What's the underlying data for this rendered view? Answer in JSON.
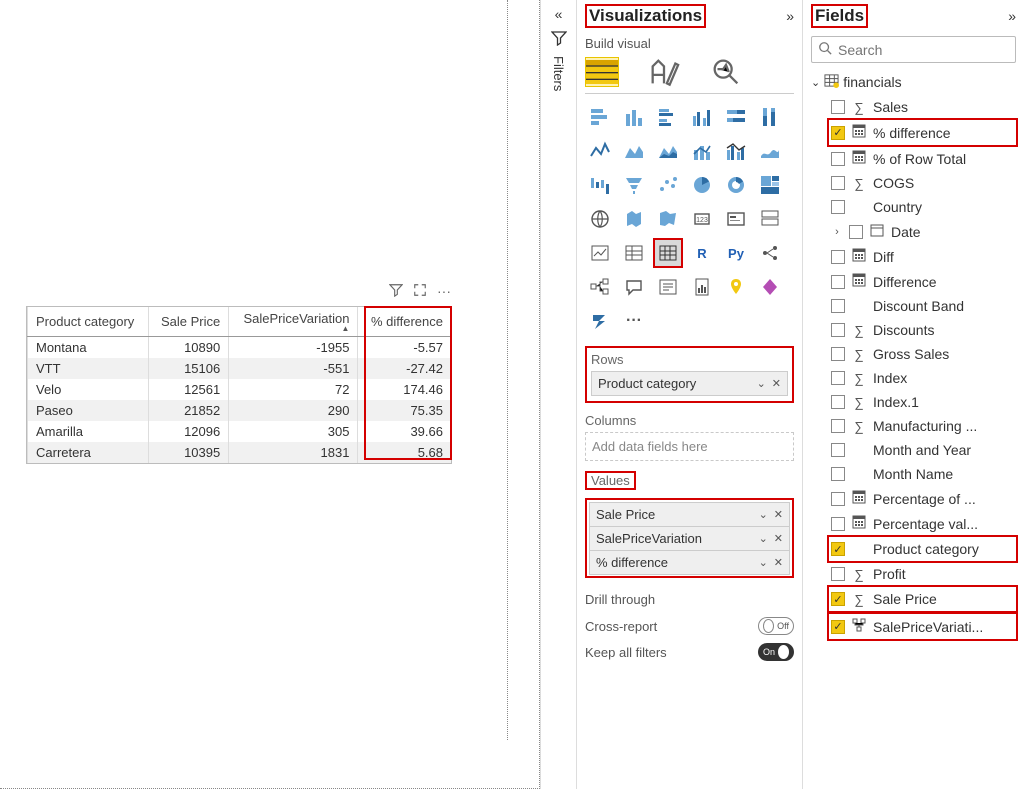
{
  "filters": {
    "label": "Filters"
  },
  "visualizations": {
    "title": "Visualizations",
    "build_visual": "Build visual",
    "wells": {
      "rows": {
        "label": "Rows",
        "items": [
          "Product category"
        ]
      },
      "columns": {
        "label": "Columns",
        "placeholder": "Add data fields here"
      },
      "values": {
        "label": "Values",
        "items": [
          "Sale Price",
          "SalePriceVariation",
          "% difference"
        ]
      }
    },
    "drill": {
      "title": "Drill through",
      "cross_report": "Cross-report",
      "keep_all_filters": "Keep all filters",
      "off_label": "Off",
      "on_label": "On"
    },
    "icons": {
      "r": "R",
      "py": "Py",
      "dots": "···"
    }
  },
  "fields_panel": {
    "title": "Fields",
    "search_placeholder": "Search",
    "table_name": "financials",
    "fields": [
      {
        "label": "Sales",
        "icon": "sigma",
        "checked": false
      },
      {
        "label": "% difference",
        "icon": "calc",
        "checked": true,
        "hl": true
      },
      {
        "label": "% of Row Total",
        "icon": "calc",
        "checked": false
      },
      {
        "label": "COGS",
        "icon": "sigma",
        "checked": false
      },
      {
        "label": "Country",
        "icon": "",
        "checked": false
      },
      {
        "label": "Date",
        "icon": "date",
        "checked": false,
        "expand": true
      },
      {
        "label": "Diff",
        "icon": "calc",
        "checked": false
      },
      {
        "label": "Difference",
        "icon": "calc",
        "checked": false
      },
      {
        "label": "Discount Band",
        "icon": "",
        "checked": false
      },
      {
        "label": "Discounts",
        "icon": "sigma",
        "checked": false
      },
      {
        "label": "Gross Sales",
        "icon": "sigma",
        "checked": false
      },
      {
        "label": "Index",
        "icon": "sigma",
        "checked": false
      },
      {
        "label": "Index.1",
        "icon": "sigma",
        "checked": false
      },
      {
        "label": "Manufacturing ...",
        "icon": "sigma",
        "checked": false
      },
      {
        "label": "Month and Year",
        "icon": "",
        "checked": false
      },
      {
        "label": "Month Name",
        "icon": "",
        "checked": false
      },
      {
        "label": "Percentage of ...",
        "icon": "calc",
        "checked": false
      },
      {
        "label": "Percentage val...",
        "icon": "calc",
        "checked": false
      },
      {
        "label": "Product category",
        "icon": "",
        "checked": true,
        "hl": true
      },
      {
        "label": "Profit",
        "icon": "sigma",
        "checked": false
      },
      {
        "label": "Sale Price",
        "icon": "sigma",
        "checked": true,
        "hl": true
      },
      {
        "label": "SalePriceVariati...",
        "icon": "hier",
        "checked": true,
        "hl": true
      }
    ]
  },
  "table_visual": {
    "columns": [
      "Product category",
      "Sale Price",
      "SalePriceVariation",
      "% difference"
    ],
    "sort_col": 2,
    "rows": [
      {
        "cat": "Montana",
        "sp": "10890",
        "spv": "-1955",
        "diff": "-5.57"
      },
      {
        "cat": "VTT",
        "sp": "15106",
        "spv": "-551",
        "diff": "-27.42"
      },
      {
        "cat": "Velo",
        "sp": "12561",
        "spv": "72",
        "diff": "174.46"
      },
      {
        "cat": "Paseo",
        "sp": "21852",
        "spv": "290",
        "diff": "75.35"
      },
      {
        "cat": "Amarilla",
        "sp": "12096",
        "spv": "305",
        "diff": "39.66"
      },
      {
        "cat": "Carretera",
        "sp": "10395",
        "spv": "1831",
        "diff": "5.68"
      }
    ]
  },
  "chart_data": {
    "type": "table",
    "columns": [
      "Product category",
      "Sale Price",
      "SalePriceVariation",
      "% difference"
    ],
    "rows": [
      [
        "Montana",
        10890,
        -1955,
        -5.57
      ],
      [
        "VTT",
        15106,
        -551,
        -27.42
      ],
      [
        "Velo",
        12561,
        72,
        174.46
      ],
      [
        "Paseo",
        21852,
        290,
        75.35
      ],
      [
        "Amarilla",
        12096,
        305,
        39.66
      ],
      [
        "Carretera",
        10395,
        1831,
        5.68
      ]
    ]
  }
}
